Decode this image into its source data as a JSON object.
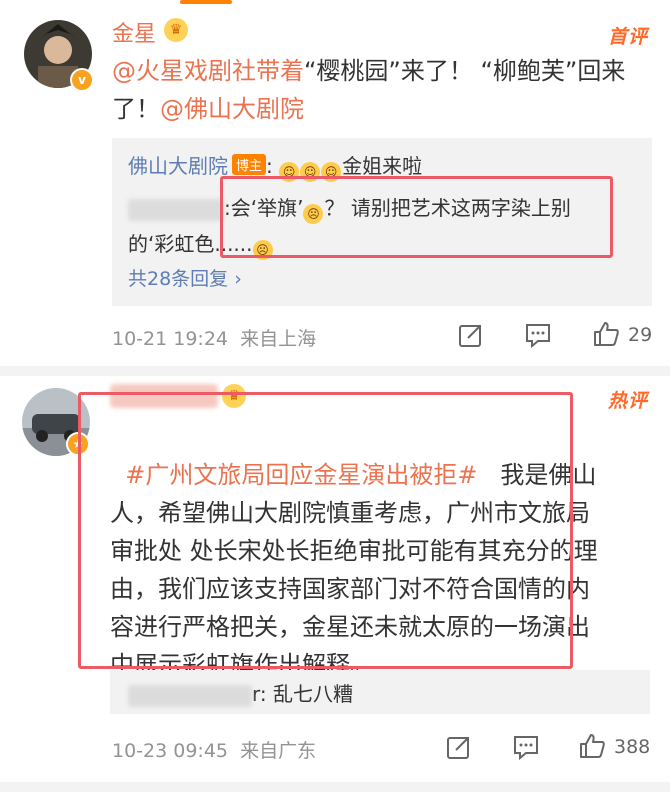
{
  "comments": [
    {
      "user_name": "金星",
      "tag": "首评",
      "text_link": "@火星戏剧社带着",
      "text_a": "“樱桃园”来了！ “柳鲍芙”回来",
      "text_b": "了！",
      "text_link2": "@佛山大剧院",
      "replies": [
        {
          "user": "佛山大剧院",
          "badge": "博主",
          "sep": ":",
          "text": "金姐来啦"
        },
        {
          "user_blur": "▒▒▒▒▒▒▒▒▒",
          "sep": ":",
          "text_a": "会‘举旗’",
          "text_b": "？ 请别把艺术这两字染上别",
          "text_c": "的‘彩虹色......"
        }
      ],
      "more_replies": "共28条回复 ›",
      "date": "10-21 19:24",
      "source": "来自上海",
      "likes": "29"
    },
    {
      "user_name_blur": "▒▒▒▒▒▒▒▒▒▒",
      "tag": "热评",
      "text_link": "#广州文旅局回应金星演出被拒#",
      "lines": [
        "   我是佛山",
        "人，希望佛山大剧院慎重考虑，广州市文旅局",
        "审批处 处长宋处长拒绝审批可能有其充分的理",
        "由，我们应该支持国家部门对不符合国情的内",
        "容进行严格把关，金星还未就太原的一场演出",
        "中展示彩虹旗作出解释。"
      ],
      "reply": {
        "user_blur": "▒▒▒▒▒▒▒▒▒",
        "sep": "r:",
        "text": "乱七八糟"
      },
      "date": "10-23 09:45",
      "source": "来自广东",
      "likes": "388"
    }
  ],
  "colors": {
    "accent": "#eb7350",
    "tag": "#ff6a2b",
    "highlight": "#ec5b65",
    "link_blue": "#5e7db3"
  },
  "icons": [
    "share-icon",
    "comment-icon",
    "like-icon",
    "crown-icon",
    "verified-icon"
  ]
}
